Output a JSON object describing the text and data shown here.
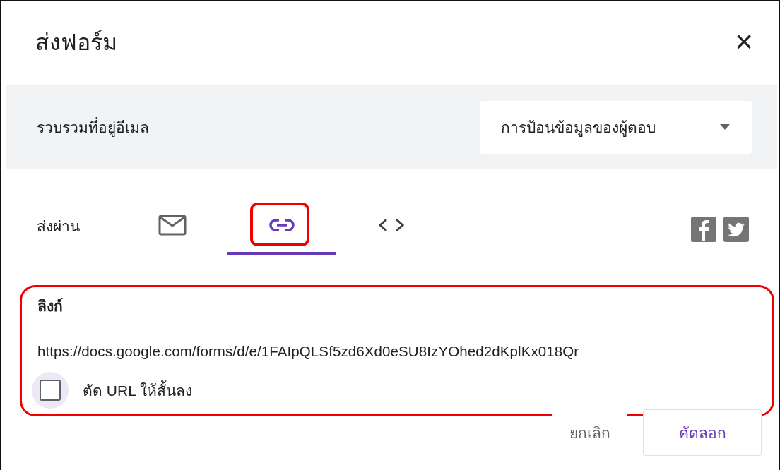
{
  "dialog": {
    "title": "ส่งฟอร์ม",
    "close": "×"
  },
  "collect_email": {
    "label": "รวบรวมที่อยู่อีเมล",
    "dropdown_value": "การป้อนข้อมูลของผู้ตอบ"
  },
  "send_via": {
    "label": "ส่งผ่าน",
    "tabs": [
      {
        "kind": "email",
        "selected": false,
        "highlighted": false
      },
      {
        "kind": "link",
        "selected": true,
        "highlighted": true
      },
      {
        "kind": "embed",
        "selected": false,
        "highlighted": false
      }
    ]
  },
  "link_section": {
    "highlighted": true,
    "heading": "ลิงก์",
    "url": "https://docs.google.com/forms/d/e/1FAIpQLSf5zd6Xd0eSU8IzYOhed2dKplKx018Qr",
    "shorten": {
      "label": "ตัด URL ให้สั้นลง",
      "checked": false
    }
  },
  "buttons": [
    {
      "label": "ยกเลิก",
      "kind": "text"
    },
    {
      "label": "คัดลอก",
      "kind": "outlined"
    }
  ]
}
